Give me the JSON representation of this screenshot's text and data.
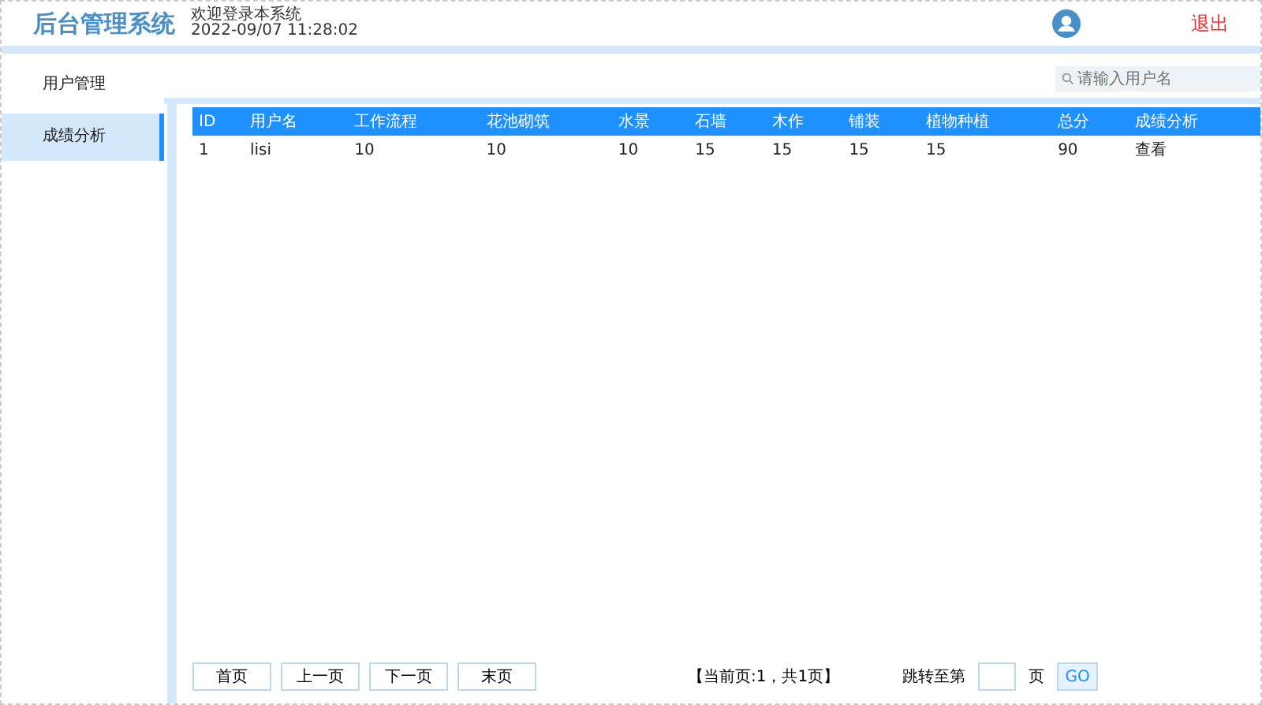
{
  "header": {
    "title": "后台管理系统",
    "welcome": "欢迎登录本系统",
    "datetime": "2022-09/07 11:28:02",
    "logout": "退出"
  },
  "sidebar": {
    "items": [
      {
        "label": "用户管理",
        "selected": false
      },
      {
        "label": "成绩分析",
        "selected": true
      }
    ]
  },
  "search": {
    "placeholder": "请输入用户名"
  },
  "table": {
    "columns": [
      "ID",
      "用户名",
      "工作流程",
      "花池砌筑",
      "水景",
      "石墙",
      "木作",
      "铺装",
      "植物种植",
      "总分",
      "成绩分析"
    ],
    "rows": [
      [
        "1",
        "lisi",
        "10",
        "10",
        "10",
        "15",
        "15",
        "15",
        "15",
        "90",
        "查看"
      ]
    ]
  },
  "pagination": {
    "buttons": [
      "首页",
      "上一页",
      "下一页",
      "末页"
    ],
    "status": "【当前页:1，共1页】",
    "jump_label": "跳转至第",
    "page_unit": "页",
    "go": "GO"
  }
}
